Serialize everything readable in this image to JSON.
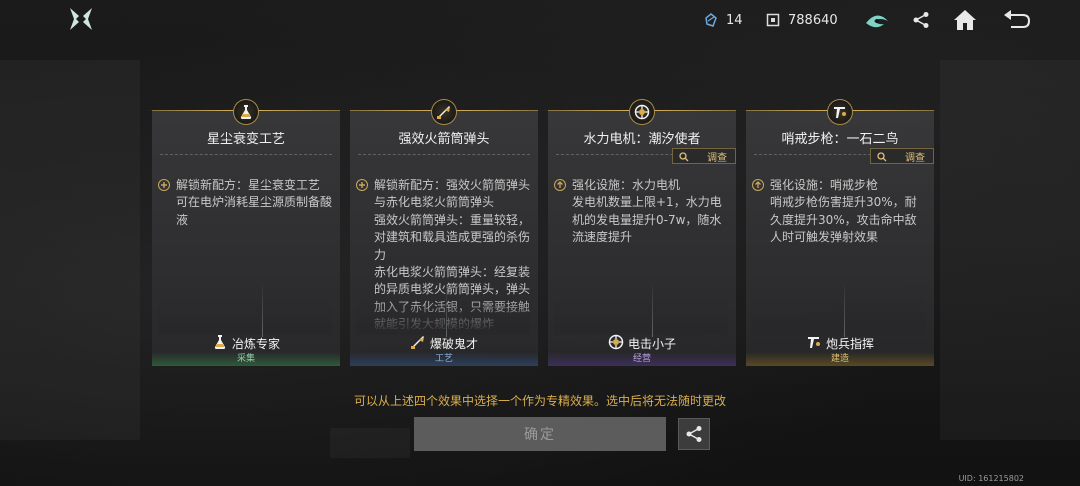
{
  "topbar": {
    "icons": [
      "game-logo-icon",
      "energy-crystal-icon",
      "currency-icon",
      "faction-emblem-icon",
      "share-icon",
      "home-icon",
      "back-icon"
    ],
    "energy_count": "14",
    "currency_amount": "788640"
  },
  "cards": [
    {
      "icon": "flask-icon",
      "title": "星尘衰变工艺",
      "has_investigate": false,
      "investigate_label": "",
      "effects": [
        {
          "icon": "plus-icon",
          "text": "解锁新配方：星尘衰变工艺\n可在电炉消耗星尘源质制备酸液"
        }
      ],
      "reward_icon": "flask-icon",
      "reward_title": "冶炼专家",
      "category": "采集",
      "category_color": "#2e5a3a",
      "category_text_color": "#8fd1a0"
    },
    {
      "icon": "rocket-icon",
      "title": "强效火箭筒弹头",
      "has_investigate": false,
      "investigate_label": "",
      "effects": [
        {
          "icon": "plus-icon",
          "text": "解锁新配方：强效火箭筒弹头与赤化电浆火箭筒弹头\n强效火箭筒弹头：重量较轻，对建筑和载具造成更强的杀伤力\n赤化电浆火箭筒弹头：经复装的异质电浆火箭筒弹头，弹头加入了赤化活银，只需要接触就能引发大规模的爆炸"
        }
      ],
      "reward_icon": "rocket-icon",
      "reward_title": "爆破鬼才",
      "category": "工艺",
      "category_color": "#2d3f5c",
      "category_text_color": "#8fb0e0"
    },
    {
      "icon": "generator-icon",
      "title": "水力电机：潮汐使者",
      "has_investigate": true,
      "investigate_label": "调查",
      "effects": [
        {
          "icon": "arrow-up-icon",
          "text": "强化设施：水力电机\n发电机数量上限+1，水力电机的发电量提升0-7w，随水流速度提升"
        }
      ],
      "reward_icon": "generator-icon",
      "reward_title": "电击小子",
      "category": "经营",
      "category_color": "#3d2f5a",
      "category_text_color": "#b7a0e6"
    },
    {
      "icon": "rifle-icon",
      "title": "哨戒步枪：一石二鸟",
      "has_investigate": true,
      "investigate_label": "调查",
      "effects": [
        {
          "icon": "arrow-up-icon",
          "text": "强化设施：哨戒步枪\n哨戒步枪伤害提升30%，耐久度提升30%，攻击命中敌人时可触发弹射效果"
        }
      ],
      "reward_icon": "rifle-icon",
      "reward_title": "炮兵指挥",
      "category": "建造",
      "category_color": "#5a4a22",
      "category_text_color": "#e0c070"
    }
  ],
  "hint": "可以从上述四个效果中选择一个作为专精效果。选中后将无法随时更改",
  "confirm_label": "确定",
  "share_icon": "share-icon",
  "uid": "UID: 161215802",
  "colors": {
    "accent_gold": "#d9ad4d",
    "card_bg": "#3a3a3c",
    "confirm_bg": "#5c5c5c"
  }
}
